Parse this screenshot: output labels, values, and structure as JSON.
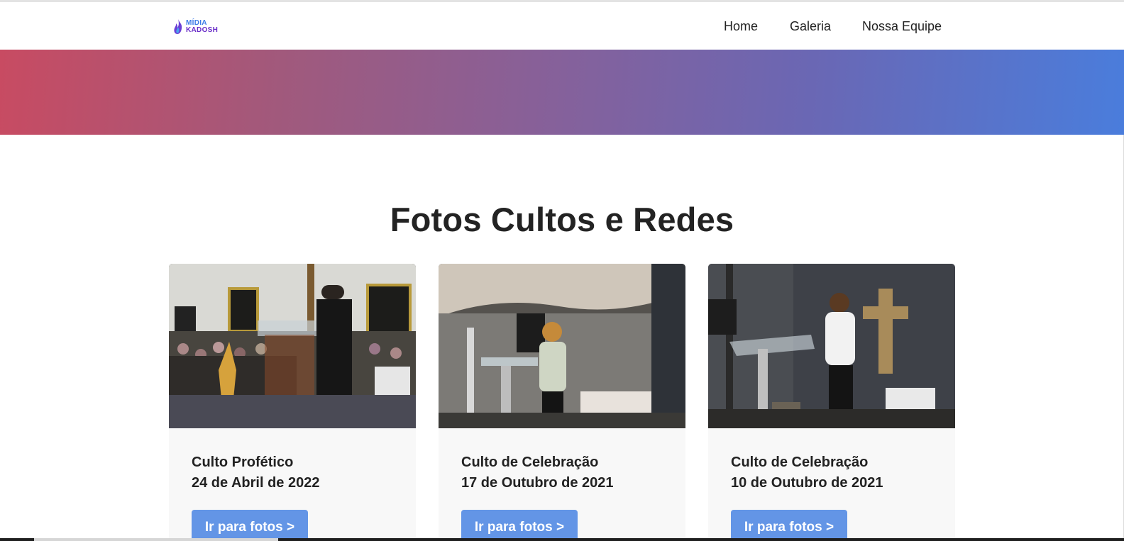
{
  "brand": {
    "logo_line1": "MÍDIA",
    "logo_line2": "KADOSH",
    "colors": {
      "flame": "#6b3fd6",
      "accent": "#3b7be8"
    }
  },
  "nav": {
    "items": [
      {
        "label": "Home"
      },
      {
        "label": "Galeria"
      },
      {
        "label": "Nossa Equipe"
      }
    ]
  },
  "hero": {
    "gradient_start": "#c84b62",
    "gradient_end": "#4a7ddc"
  },
  "section": {
    "title": "Fotos Cultos e Redes"
  },
  "cards": [
    {
      "title": "Culto Profético",
      "date": "24 de Abril de 2022",
      "button": "Ir para fotos >"
    },
    {
      "title": "Culto de Celebração",
      "date": "17 de Outubro de 2021",
      "button": "Ir para fotos >"
    },
    {
      "title": "Culto de Celebração",
      "date": "10 de Outubro de 2021",
      "button": "Ir para fotos >"
    }
  ],
  "theme": {
    "button_color": "#6395e6",
    "card_bg": "#f8f8f8"
  }
}
